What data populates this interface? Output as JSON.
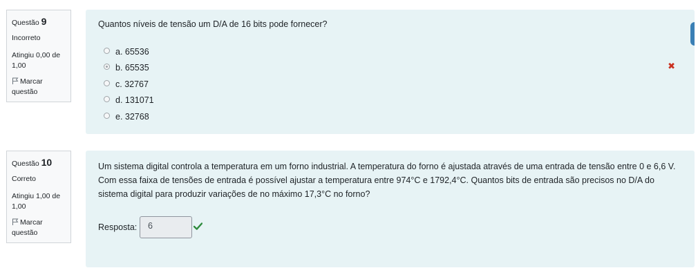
{
  "q9": {
    "label": "Questão",
    "number": "9",
    "state": "Incorreto",
    "grade": "Atingiu 0,00 de 1,00",
    "flag": "Marcar questão",
    "text": "Quantos níveis de tensão um D/A de 16 bits pode fornecer?",
    "answers": [
      "a. 65536",
      "b. 65535",
      "c. 32767",
      "d. 131071",
      "e. 32768"
    ],
    "selected_index": 1,
    "result_icon": "cross-icon"
  },
  "q10": {
    "label": "Questão",
    "number": "10",
    "state": "Correto",
    "grade": "Atingiu 1,00 de 1,00",
    "flag": "Marcar questão",
    "text": "Um sistema digital controla a temperatura em um forno industrial. A temperatura do forno é ajustada através de uma entrada de tensão entre 0 e 6,6 V. Com essa faixa de tensões de entrada é possível ajustar a temperatura entre 974°C e 1792,4°C. Quantos bits de entrada são precisos no D/A do sistema digital para produzir variações de no máximo 17,3°C no forno?",
    "response_label": "Resposta:",
    "response_value": "6",
    "result_icon": "check-icon"
  },
  "colors": {
    "correct": "#2e8b3d",
    "incorrect": "#ca3120",
    "panel": "#e7f3f5"
  }
}
